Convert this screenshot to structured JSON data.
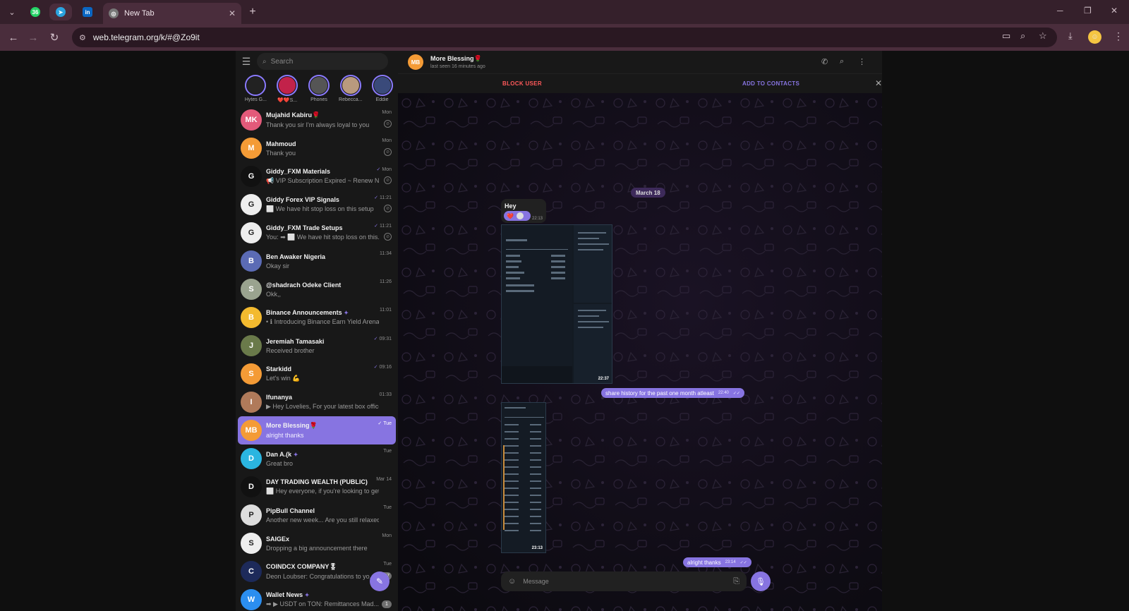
{
  "browser": {
    "tab_title": "New Tab",
    "url": "web.telegram.org/k/#@Zo9it",
    "pinned_badge": "36"
  },
  "sidebar": {
    "search_placeholder": "Search",
    "stories": [
      {
        "name": "Hytes G...",
        "color": "#222"
      },
      {
        "name": "❤️❤️S...",
        "color": "#c2224a"
      },
      {
        "name": "Phones",
        "color": "#555"
      },
      {
        "name": "Rebecca...",
        "color": "#b99a7e"
      },
      {
        "name": "Eddie",
        "color": "#3a4a7a"
      }
    ],
    "chats": [
      {
        "name": "Mujahid Kabiru🌹",
        "msg": "Thank you sir I'm always loyal to you",
        "time": "Mon",
        "initials": "MK",
        "color": "#e35a7a",
        "pin": true
      },
      {
        "name": "Mahmoud",
        "msg": "Thank you",
        "time": "Mon",
        "initials": "M",
        "color": "#f49b36",
        "pin": true
      },
      {
        "name": "Giddy_FXM Materials",
        "msg": "📢 VIP Subscription Expired ~ Renew N...",
        "time": "Mon",
        "initials": "G",
        "color": "#111",
        "pin": true,
        "check": true
      },
      {
        "name": "Giddy Forex VIP Signals",
        "msg": "⬜ We have hit stop loss on this setup",
        "time": "11:21",
        "initials": "G",
        "color": "#eee",
        "pin": true,
        "check": true
      },
      {
        "name": "Giddy_FXM Trade Setups",
        "msg": "You: ➡ ⬜ We have hit stop loss on this...",
        "time": "11:21",
        "initials": "G",
        "color": "#eee",
        "pin": true,
        "check": true
      },
      {
        "name": "Ben Awaker Nigeria",
        "msg": "Okay sir",
        "time": "11:34",
        "initials": "B",
        "color": "#5b6bb5"
      },
      {
        "name": "@shadrach Odeke Client",
        "msg": "Okk,,",
        "time": "11:26",
        "initials": "S",
        "color": "#9aa38f"
      },
      {
        "name": "Binance Announcements",
        "msg": "• ℹ Introducing Binance Earn Yield Arena wi...",
        "time": "11:01",
        "initials": "B",
        "color": "#f3ba2f",
        "verified": true
      },
      {
        "name": "Jeremiah Tamasaki",
        "msg": "Received brother",
        "time": "09:31",
        "initials": "J",
        "color": "#6a7a4a",
        "check": true
      },
      {
        "name": "Starkidd",
        "msg": "Let's win 💪",
        "time": "09:16",
        "initials": "S",
        "color": "#f49b36",
        "check": true
      },
      {
        "name": "Ifunanya",
        "msg": "▶ Hey Lovelies, For your latest box office ...",
        "time": "01:33",
        "initials": "I",
        "color": "#b07a5a"
      },
      {
        "name": "More Blessing🌹",
        "msg": "alright thanks",
        "time": "Tue",
        "initials": "MB",
        "color": "#f49b36",
        "selected": true,
        "check": true
      },
      {
        "name": "Dan A.(k",
        "msg": "Great bro",
        "time": "Tue",
        "initials": "D",
        "color": "#2bb5e0",
        "verified": true
      },
      {
        "name": "DAY TRADING WEALTH (PUBLIC)",
        "msg": "⬜ Hey everyone, if you're looking to get fu...",
        "time": "Mar 14",
        "initials": "D",
        "color": "#111"
      },
      {
        "name": "PipBull Channel",
        "msg": "Another new week... Are you still relaxed? ...",
        "time": "Tue",
        "initials": "P",
        "color": "#ddd"
      },
      {
        "name": "SAIGEx",
        "msg": "Dropping a big announcement there",
        "time": "Mon",
        "initials": "S",
        "color": "#eee"
      },
      {
        "name": "COINDCX COMPANY🎖",
        "msg": "Deon Loubser: Congratulations to yo...",
        "time": "Tue",
        "initials": "C",
        "color": "#1d2a5a",
        "badge": "387"
      },
      {
        "name": "Wallet News",
        "msg": "➡ ▶ USDT on TON: Remittances Mad...",
        "time": "",
        "initials": "W",
        "color": "#2b8ef0",
        "badge": "1",
        "verified": true
      }
    ]
  },
  "chat": {
    "name": "More Blessing🌹",
    "initials": "MB",
    "status": "last seen 16 minutes ago",
    "block_label": "BLOCK USER",
    "add_label": "ADD TO CONTACTS",
    "date_label": "March 18",
    "hey_text": "Hey",
    "hey_time": "22:13",
    "reaction": "❤️",
    "shot1_time": "22:37",
    "out1_text": "share history for the past one month atleast",
    "out1_time": "22:40",
    "shot2_time": "23:13",
    "out2_text": "alright thanks",
    "out2_time": "23:14",
    "composer_placeholder": "Message"
  },
  "colors": {
    "accent": "#8774e1",
    "danger": "#ff595a",
    "chrome": "#4a2d3c"
  }
}
